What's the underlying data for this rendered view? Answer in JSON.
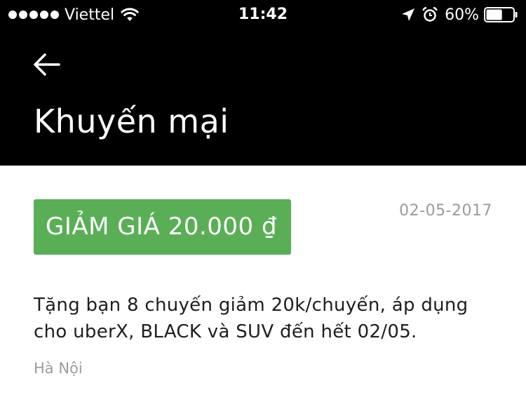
{
  "status_bar": {
    "carrier": "Viettel",
    "time": "11:42",
    "battery": "60%",
    "battery_level": 0.6,
    "icons": [
      "signal-dots",
      "wifi-icon",
      "location-arrow-icon",
      "alarm-icon",
      "battery-icon"
    ]
  },
  "header": {
    "back_icon": "arrow-left-icon",
    "title": "Khuyến mại",
    "background": "#000000"
  },
  "promo": {
    "badge": "GIẢM GIÁ 20.000 ₫",
    "badge_color": "#5aaf56",
    "date": "02-05-2017",
    "description": "Tặng bạn 8 chuyến giảm 20k/chuyến, áp dụng cho uberX, BLACK và SUV đến hết 02/05.",
    "city": "Hà Nội"
  }
}
